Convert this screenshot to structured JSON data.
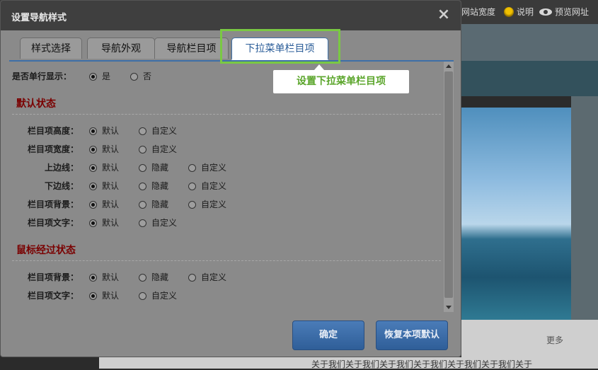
{
  "background": {
    "topbar_items": [
      "网站宽度",
      "说明",
      "预览网址"
    ],
    "more_link": "更多",
    "bottom_text": "关于我们关于我们关于我们关于我们关于我们关于我们关于"
  },
  "dialog": {
    "title": "设置导航样式",
    "tabs": [
      "样式选择",
      "导航外观",
      "导航栏目项",
      "下拉菜单栏目项"
    ],
    "active_tab": 3,
    "tooltip": "设置下拉菜单栏目项",
    "single_row": {
      "label": "是否单行显示：",
      "options": [
        "是",
        "否"
      ],
      "selected": 0
    },
    "section_default": {
      "title": "默认状态",
      "rows": [
        {
          "label": "栏目项高度：",
          "options": [
            "默认",
            "自定义"
          ],
          "selected": 0
        },
        {
          "label": "栏目项宽度：",
          "options": [
            "默认",
            "自定义"
          ],
          "selected": 0
        },
        {
          "label": "上边线：",
          "options": [
            "默认",
            "隐藏",
            "自定义"
          ],
          "selected": 0
        },
        {
          "label": "下边线：",
          "options": [
            "默认",
            "隐藏",
            "自定义"
          ],
          "selected": 0
        },
        {
          "label": "栏目项背景：",
          "options": [
            "默认",
            "隐藏",
            "自定义"
          ],
          "selected": 0
        },
        {
          "label": "栏目项文字：",
          "options": [
            "默认",
            "自定义"
          ],
          "selected": 0
        }
      ]
    },
    "section_hover": {
      "title": "鼠标经过状态",
      "rows": [
        {
          "label": "栏目项背景：",
          "options": [
            "默认",
            "隐藏",
            "自定义"
          ],
          "selected": 0
        },
        {
          "label": "栏目项文字：",
          "options": [
            "默认",
            "自定义"
          ],
          "selected": 0
        }
      ]
    },
    "buttons": {
      "confirm": "确定",
      "restore": "恢复本项默认"
    }
  },
  "colors": {
    "accent": "#3d6fa8",
    "section_title": "#7a0000",
    "highlight": "#7ac943"
  }
}
